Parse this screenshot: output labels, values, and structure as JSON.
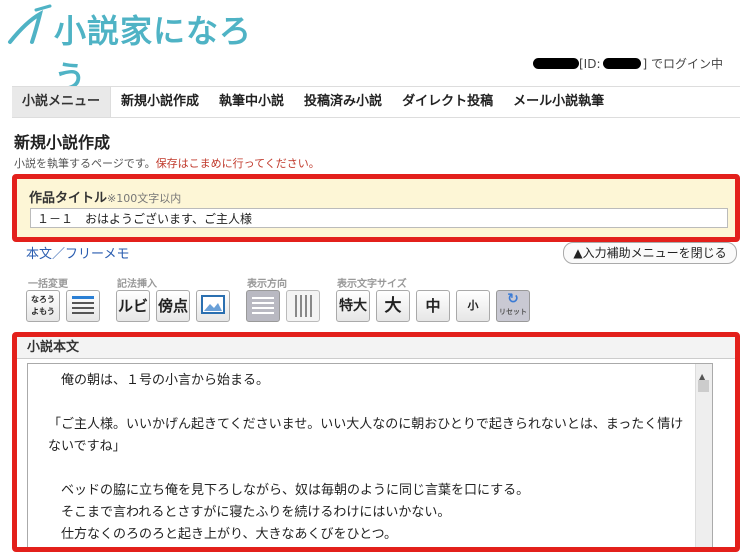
{
  "header": {
    "logo_text": "小説家になろう",
    "login_id_label": "[ID:",
    "login_suffix": "] でログイン中"
  },
  "nav": {
    "items": [
      {
        "label": "小説メニュー",
        "active": true
      },
      {
        "label": "新規小説作成"
      },
      {
        "label": "執筆中小説"
      },
      {
        "label": "投稿済み小説"
      },
      {
        "label": "ダイレクト投稿"
      },
      {
        "label": "メール小説執筆"
      }
    ]
  },
  "page": {
    "title": "新規小説作成",
    "description": "小説を執筆するページです。",
    "warning": "保存はこまめに行ってください。"
  },
  "title_field": {
    "label": "作品タイトル",
    "note": "※100文字以内",
    "value": "１－１　おはようございます、ご主人様"
  },
  "editor": {
    "tab_label": "本文／フリーメモ",
    "close_helper": "▲入力補助メニューを閉じる",
    "groups": [
      "一括変更",
      "記法挿入",
      "表示方向",
      "表示文字サイズ"
    ],
    "tools": {
      "batch_text": "なろう",
      "batch_sub": "よもう",
      "ruby": "ルビ",
      "emphasis": "傍点",
      "size_xl": "特大",
      "size_l": "大",
      "size_m": "中",
      "size_s": "小",
      "reset": "リセット"
    },
    "body_label": "小説本文",
    "body_lines": [
      "　俺の朝は、１号の小言から始まる。",
      "",
      "「ご主人様。いいかげん起きてくださいませ。いい大人なのに朝おひとりで起きられないとは、まったく情けないですね」",
      "",
      "　ベッドの脇に立ち俺を見下ろしながら、奴は毎朝のように同じ言葉を口にする。",
      "　そこまで言われるとさすがに寝たふりを続けるわけにはいかない。",
      "　仕方なくのろのろと起き上がり、大きなあくびをひとつ。"
    ]
  },
  "colors": {
    "highlight_border": "#e3201b",
    "logo": "#4fb3c5",
    "warning": "#c0392b",
    "title_bg": "#fdf6d6"
  }
}
